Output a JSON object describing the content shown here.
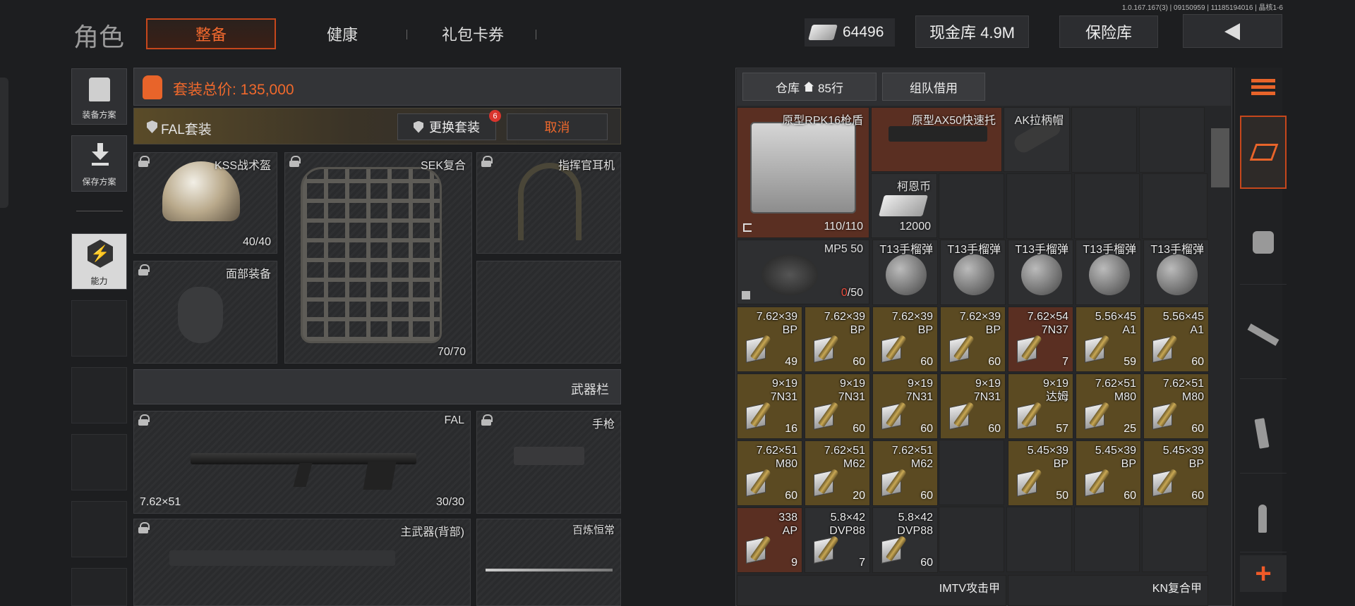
{
  "version_text": "1.0.167.167(3) | 09150959 | 11185194016 | 晶核1-6",
  "header": {
    "title": "角色",
    "tabs": [
      "整备",
      "健康",
      "礼包卡券"
    ],
    "active_tab": 0,
    "money": "64496",
    "cash_vault": "现金库 4.9M",
    "insurance": "保险库",
    "back_icon": "chevron-left-icon"
  },
  "sidebar": {
    "items": [
      {
        "label": "装备方案",
        "icon": "vest-plan-icon"
      },
      {
        "label": "保存方案",
        "icon": "download-save-icon"
      },
      {
        "label": "能力",
        "icon": "lightning-hex-icon"
      }
    ]
  },
  "loadout": {
    "total_value": "套装总价: 135,000",
    "suit_name": "FAL套装",
    "change_suit": "更换套装",
    "change_badge": "6",
    "cancel": "取消",
    "slots": [
      {
        "title": "KSS战术盔",
        "count": "40/40"
      },
      {
        "title": "SEK复合",
        "count": "70/70"
      },
      {
        "title": "指挥官耳机",
        "count": ""
      },
      {
        "title": "面部装备",
        "count": ""
      },
      {
        "title": "",
        "count": ""
      }
    ],
    "weapons_header": "武器栏",
    "weapons": [
      {
        "title": "FAL",
        "caliber": "7.62×51",
        "count": "30/30"
      },
      {
        "title": "手枪",
        "caliber": "",
        "count": ""
      },
      {
        "title": "主武器(背部)",
        "caliber": "",
        "count": ""
      },
      {
        "title": "百炼恒常",
        "caliber": "",
        "count": ""
      }
    ]
  },
  "storage": {
    "tab_warehouse": "仓库",
    "rows": "85行",
    "tab_team": "组队借用",
    "large_items": [
      {
        "name": "原型RPK16枪盾",
        "count": "110/110"
      },
      {
        "name": "原型AX50快速托",
        "count": ""
      },
      {
        "name": "AK拉柄帽",
        "count": ""
      },
      {
        "name": "柯恩币",
        "count": "12000"
      },
      {
        "name": "MP5 50",
        "count_red": "0",
        "count_rest": "/50"
      }
    ],
    "grenades": [
      "T13手榴弹",
      "T13手榴弹",
      "T13手榴弹",
      "T13手榴弹",
      "T13手榴弹"
    ],
    "ammo": [
      {
        "l1": "7.62×39",
        "l2": "BP",
        "q": "49"
      },
      {
        "l1": "7.62×39",
        "l2": "BP",
        "q": "60"
      },
      {
        "l1": "7.62×39",
        "l2": "BP",
        "q": "60"
      },
      {
        "l1": "7.62×39",
        "l2": "BP",
        "q": "60"
      },
      {
        "l1": "7.62×54",
        "l2": "7N37",
        "q": "7"
      },
      {
        "l1": "5.56×45",
        "l2": "A1",
        "q": "59"
      },
      {
        "l1": "5.56×45",
        "l2": "A1",
        "q": "60"
      },
      {
        "l1": "9×19",
        "l2": "7N31",
        "q": "16"
      },
      {
        "l1": "9×19",
        "l2": "7N31",
        "q": "60"
      },
      {
        "l1": "9×19",
        "l2": "7N31",
        "q": "60"
      },
      {
        "l1": "9×19",
        "l2": "7N31",
        "q": "60"
      },
      {
        "l1": "9×19",
        "l2": "达姆",
        "q": "57"
      },
      {
        "l1": "7.62×51",
        "l2": "M80",
        "q": "25"
      },
      {
        "l1": "7.62×51",
        "l2": "M80",
        "q": "60"
      },
      {
        "l1": "7.62×51",
        "l2": "M80",
        "q": "60"
      },
      {
        "l1": "7.62×51",
        "l2": "M62",
        "q": "20"
      },
      {
        "l1": "7.62×51",
        "l2": "M62",
        "q": "60"
      },
      {
        "l1": "5.45×39",
        "l2": "BP",
        "q": "50"
      },
      {
        "l1": "5.45×39",
        "l2": "BP",
        "q": "60"
      },
      {
        "l1": "5.45×39",
        "l2": "BP",
        "q": "60"
      },
      {
        "l1": "338",
        "l2": "AP",
        "q": "9"
      },
      {
        "l1": "5.8×42",
        "l2": "DVP88",
        "q": "7"
      },
      {
        "l1": "5.8×42",
        "l2": "DVP88",
        "q": "60"
      }
    ],
    "bottom_labels": [
      "IMTV攻击甲",
      "KN复合甲"
    ]
  },
  "rail_icons": [
    "sort-refresh-icon",
    "stack-store-icon",
    "vest-filter-icon",
    "rifle-filter-icon",
    "magazine-filter-icon",
    "bullet-filter-icon",
    "plus-icon"
  ],
  "colors": {
    "accent": "#e8642a",
    "gold_cell": "#5b4a22",
    "red_cell": "#5a2f22"
  }
}
